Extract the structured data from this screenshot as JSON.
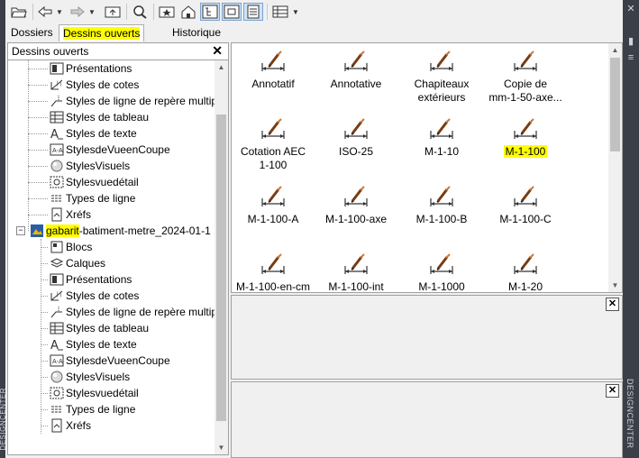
{
  "side_left": {
    "label": "DESIGNCENTER"
  },
  "side_right": {
    "label": "DESIGNCENTER"
  },
  "tabs": [
    {
      "label": "Dossiers"
    },
    {
      "label": "Dessins ouverts"
    },
    {
      "label": "Historique"
    }
  ],
  "left_panel": {
    "title": "Dessins ouverts",
    "close": "✕",
    "tree": [
      {
        "label": "Présentations"
      },
      {
        "label": "Styles de cotes"
      },
      {
        "label": "Styles de ligne de repère multip"
      },
      {
        "label": "Styles de tableau"
      },
      {
        "label": "Styles de texte"
      },
      {
        "label": "StylesdeVueenCoupe"
      },
      {
        "label": "StylesVisuels"
      },
      {
        "label": "Stylesvuedétail"
      },
      {
        "label": "Types de ligne"
      },
      {
        "label": "Xréfs"
      },
      {
        "label_hl": "gabarit",
        "label_rest": "-batiment-metre_2024-01-1"
      },
      {
        "label": "Blocs"
      },
      {
        "label": "Calques"
      },
      {
        "label": "Présentations"
      },
      {
        "label": "Styles de cotes"
      },
      {
        "label": "Styles de ligne de repère multip"
      },
      {
        "label": "Styles de tableau"
      },
      {
        "label": "Styles de texte"
      },
      {
        "label": "StylesdeVueenCoupe"
      },
      {
        "label": "StylesVisuels"
      },
      {
        "label": "Stylesvuedétail"
      },
      {
        "label": "Types de ligne"
      },
      {
        "label": "Xréfs"
      }
    ]
  },
  "content": {
    "items": [
      {
        "l1": "Annotatif",
        "l2": ""
      },
      {
        "l1": "Annotative",
        "l2": ""
      },
      {
        "l1": "Chapiteaux",
        "l2": "extérieurs"
      },
      {
        "l1": "Copie de",
        "l2": "mm-1-50-axe..."
      },
      {
        "l1": "Cotation AEC",
        "l2": "1-100"
      },
      {
        "l1": "ISO-25",
        "l2": ""
      },
      {
        "l1": "M-1-10",
        "l2": ""
      },
      {
        "l1": "M-1-100",
        "l2": ""
      },
      {
        "l1": "M-1-100-A",
        "l2": ""
      },
      {
        "l1": "M-1-100-axe",
        "l2": ""
      },
      {
        "l1": "M-1-100-B",
        "l2": ""
      },
      {
        "l1": "M-1-100-C",
        "l2": ""
      },
      {
        "l1": "M-1-100-en-cm",
        "l2": ""
      },
      {
        "l1": "M-1-100-int",
        "l2": ""
      },
      {
        "l1": "M-1-1000",
        "l2": ""
      },
      {
        "l1": "M-1-20",
        "l2": ""
      }
    ]
  },
  "preview": {
    "close": "✕"
  },
  "description": {
    "close": "✕"
  },
  "colors": {
    "highlight": "#ffff00",
    "side_bar": "#3b3f47"
  }
}
